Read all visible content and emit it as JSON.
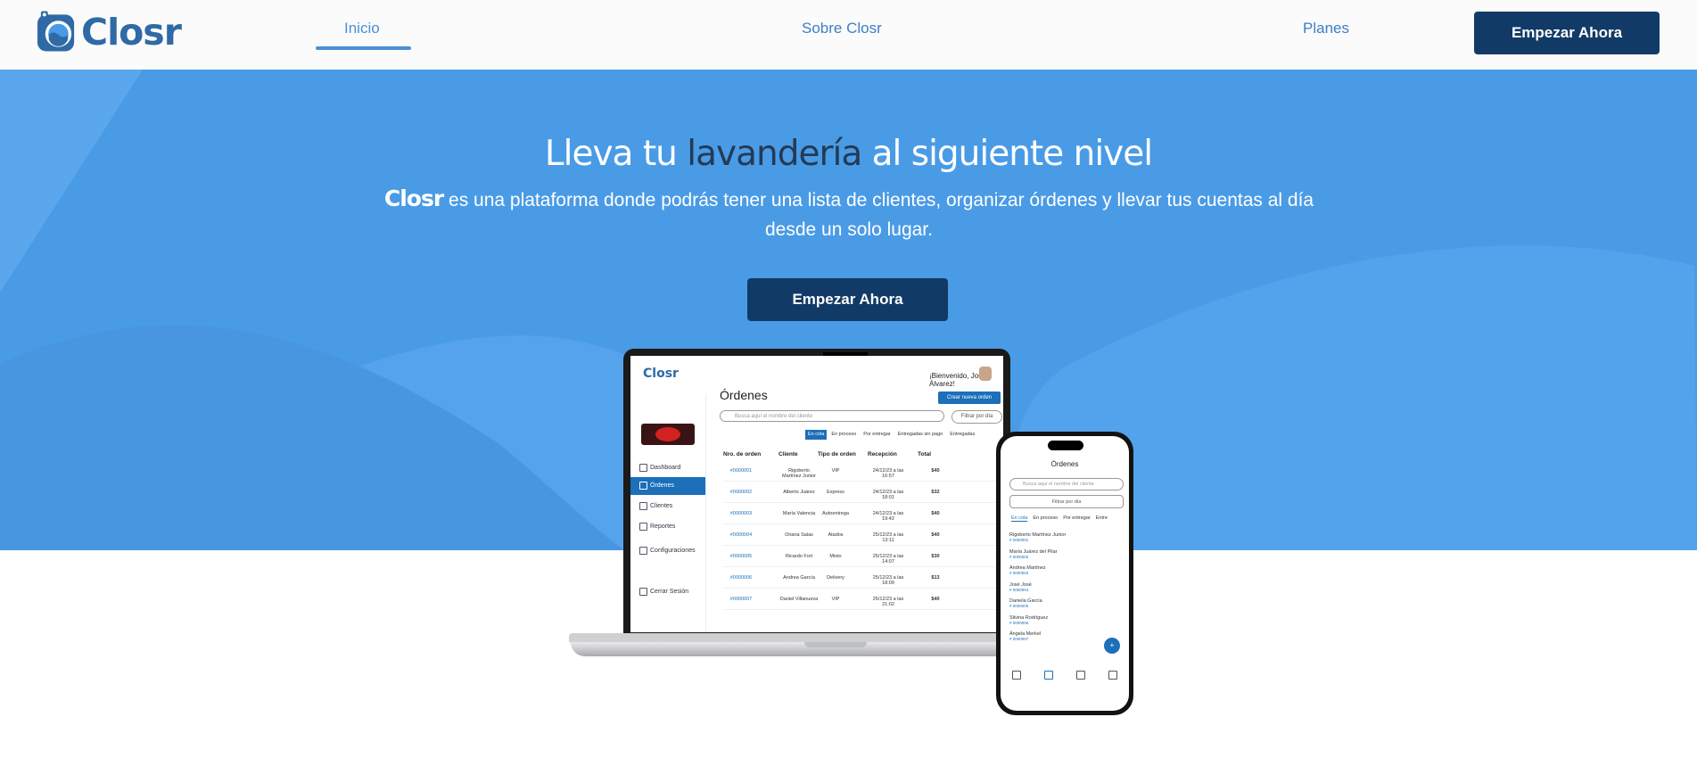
{
  "brand": {
    "name": "Closr"
  },
  "nav": {
    "links": [
      "Inicio",
      "Sobre Closr",
      "Planes"
    ],
    "cta": "Empezar Ahora"
  },
  "hero": {
    "headline_a": "Lleva tu ",
    "headline_b": "lavandería",
    "headline_c": " al siguiente nivel",
    "sub_brand": "Closr",
    "sub_text": " es una plataforma donde podrás tener una lista de clientes, organizar órdenes y llevar tus cuentas al día desde un solo lugar.",
    "cta": "Empezar Ahora"
  },
  "app": {
    "logo": "Closr",
    "welcome": "¡Bienvenido, José Álvarez!",
    "sidebar": [
      "Dashboard",
      "Órdenes",
      "Clientes",
      "Reportes",
      "Configuraciones",
      "Cerrar Sesión"
    ],
    "title": "Órdenes",
    "create": "Crear nueva orden",
    "search_placeholder": "Busca aquí el nombre del cliente",
    "filter": "Filtrar por día",
    "tabs": [
      "En cola",
      "En proceso",
      "Por entregar",
      "Entregadas sin pago",
      "Entregadas"
    ],
    "columns": [
      "Nro. de orden",
      "Cliente",
      "Tipo de orden",
      "Recepción",
      "Total"
    ],
    "rows": [
      {
        "id": "#0000001",
        "client": "Rigoberto Martínez Junior",
        "type": "VIP",
        "date": "24/12/23 a las 16:57",
        "total": "$40"
      },
      {
        "id": "#0000002",
        "client": "Alberto Juárez",
        "type": "Express",
        "date": "24/12/23 a las 18:01",
        "total": "$32"
      },
      {
        "id": "#0000003",
        "client": "María Valencia",
        "type": "Autoentrega",
        "date": "24/12/23 a las 19:42",
        "total": "$40"
      },
      {
        "id": "#0000004",
        "client": "Oriana Salas",
        "type": "Atados",
        "date": "25/12/23 a las 13:11",
        "total": "$40"
      },
      {
        "id": "#0000005",
        "client": "Ricardo Fort",
        "type": "Mixto",
        "date": "25/12/23 a las 14:07",
        "total": "$30"
      },
      {
        "id": "#0000006",
        "client": "Andrea García",
        "type": "Delivery",
        "date": "25/12/23 a las 18:09",
        "total": "$13"
      },
      {
        "id": "#0000007",
        "client": "Daniel Villanueva",
        "type": "VIP",
        "date": "25/12/23 a las 21:02",
        "total": "$40"
      }
    ]
  },
  "phone": {
    "title": "Órdenes",
    "search_placeholder": "Busca aquí el nombre del cliente",
    "filter": "Filtrar por día",
    "tabs": [
      "En cola",
      "En proceso",
      "Por entregar",
      "Entre"
    ],
    "clients": [
      {
        "name": "Rigoberto Martínez Junior",
        "id": "# 0000001"
      },
      {
        "name": "María Juárez del Pilar",
        "id": "# 0000002"
      },
      {
        "name": "Andrea Martínez",
        "id": "# 0000003"
      },
      {
        "name": "José José",
        "id": "# 0000004"
      },
      {
        "name": "Daniela García",
        "id": "# 0000005"
      },
      {
        "name": "Silvina Rodríguez",
        "id": "# 0000006"
      },
      {
        "name": "Ángela Merkel",
        "id": "# 0000007"
      }
    ],
    "fab": "+"
  },
  "colors": {
    "brand_blue": "#2f6aa6",
    "hero_bg": "#4a9be6",
    "button_dark": "#123a66",
    "accent": "#1c6fb8"
  }
}
